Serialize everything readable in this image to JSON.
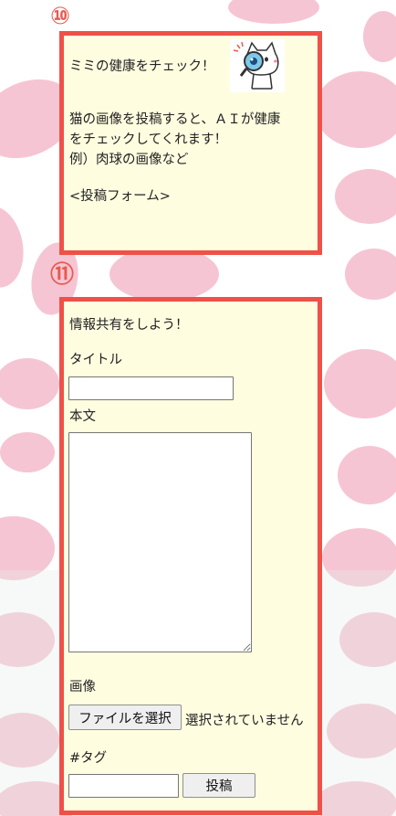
{
  "markers": {
    "first": "⑩",
    "second": "⑪"
  },
  "health_panel": {
    "heading": "ミミの健康をチェック！",
    "description_line1": "猫の画像を投稿すると、ＡＩが健康",
    "description_line2": "をチェックしてくれます！",
    "example": "例）肉球の画像など",
    "form_placeholder_text": "<投稿フォーム>",
    "illustration": "cat-with-magnifying-glass-icon"
  },
  "share_panel": {
    "heading": "情報共有をしよう！",
    "title_label": "タイトル",
    "title_value": "",
    "body_label": "本文",
    "body_value": "",
    "image_label": "画像",
    "file_button_label": "ファイルを選択",
    "file_status": "選択されていません",
    "tag_label": "#タグ",
    "tag_value": "",
    "submit_label": "投稿"
  },
  "colors": {
    "panel_border": "#ef5148",
    "panel_background": "#fffde0",
    "paw_print": "#f6c5d3",
    "marker": "#e85a4f"
  }
}
